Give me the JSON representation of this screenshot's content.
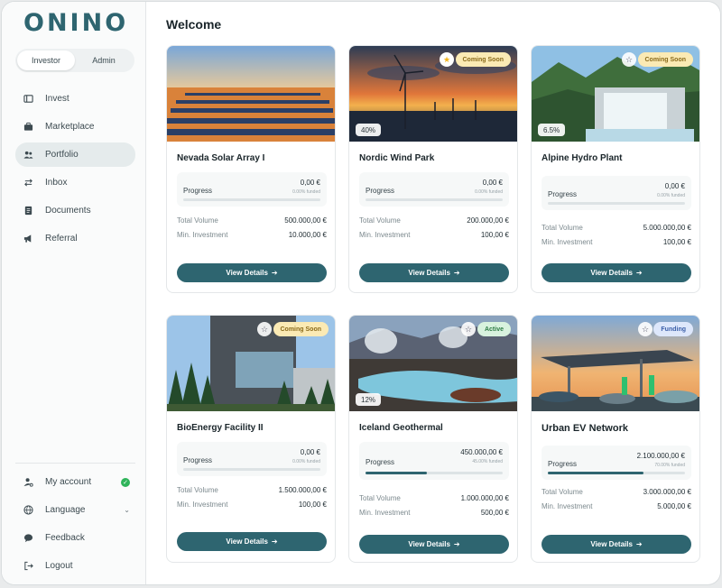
{
  "brand": {
    "logo": "ONINO",
    "accent": "#2e6570"
  },
  "role_toggle": {
    "options": [
      "Investor",
      "Admin"
    ],
    "selected": "Investor"
  },
  "nav": [
    {
      "label": "Invest",
      "icon": "wallet-icon"
    },
    {
      "label": "Marketplace",
      "icon": "briefcase-icon"
    },
    {
      "label": "Portfolio",
      "icon": "users-icon",
      "active": true
    },
    {
      "label": "Inbox",
      "icon": "arrows-icon"
    },
    {
      "label": "Documents",
      "icon": "document-icon"
    },
    {
      "label": "Referral",
      "icon": "megaphone-icon"
    }
  ],
  "bottom_nav": [
    {
      "label": "My account",
      "icon": "user-gear-icon",
      "status": "verified"
    },
    {
      "label": "Language",
      "icon": "globe-icon"
    },
    {
      "label": "Feedback",
      "icon": "chat-icon"
    },
    {
      "label": "Logout",
      "icon": "logout-icon"
    }
  ],
  "page": {
    "title": "Welcome"
  },
  "labels": {
    "progress": "Progress",
    "total_volume": "Total Volume",
    "min_investment": "Min. Investment",
    "view_details": "View Details",
    "arrow": "➔"
  },
  "projects": [
    {
      "title": "Nevada Solar Array I",
      "amount": "0,00 €",
      "funded": "0.00% funded",
      "progress": 0,
      "total_volume": "500.000,00 €",
      "min_investment": "10.000,00 €",
      "badge": "",
      "pct_chip": "",
      "favorite": false,
      "has_star": false
    },
    {
      "title": "Nordic Wind Park",
      "amount": "0,00 €",
      "funded": "0.00% funded",
      "progress": 0,
      "total_volume": "200.000,00 €",
      "min_investment": "100,00 €",
      "badge": "Coming Soon",
      "badge_type": "soon",
      "pct_chip": "40%",
      "favorite": true,
      "has_star": true
    },
    {
      "title": "Alpine Hydro Plant",
      "amount": "0,00 €",
      "funded": "0.00% funded",
      "progress": 0,
      "total_volume": "5.000.000,00 €",
      "min_investment": "100,00 €",
      "badge": "Coming Soon",
      "badge_type": "soon",
      "pct_chip": "6.5%",
      "favorite": false,
      "has_star": true
    },
    {
      "title": "BioEnergy Facility II",
      "amount": "0,00 €",
      "funded": "0.00% funded",
      "progress": 0,
      "total_volume": "1.500.000,00 €",
      "min_investment": "100,00 €",
      "badge": "Coming Soon",
      "badge_type": "soon",
      "pct_chip": "",
      "favorite": false,
      "has_star": true
    },
    {
      "title": "Iceland Geothermal",
      "amount": "450.000,00 €",
      "funded": "45.00% funded",
      "progress": 0.45,
      "total_volume": "1.000.000,00 €",
      "min_investment": "500,00 €",
      "badge": "Active",
      "badge_type": "active",
      "pct_chip": "12%",
      "favorite": false,
      "has_star": true
    },
    {
      "title": "Urban EV Network",
      "amount": "2.100.000,00 €",
      "funded": "70.00% funded",
      "progress": 0.7,
      "total_volume": "3.000.000,00 €",
      "min_investment": "5.000,00 €",
      "badge": "Funding",
      "badge_type": "funding",
      "pct_chip": "",
      "favorite": false,
      "has_star": true
    }
  ]
}
